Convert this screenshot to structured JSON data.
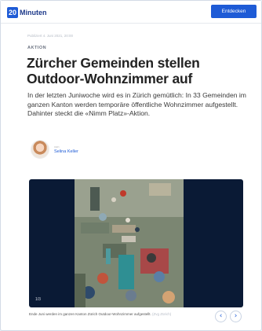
{
  "header": {
    "logo_mark": "20",
    "logo_text": "Minuten",
    "cta_label": "Entdecken"
  },
  "article": {
    "published": "Publiziert 4. Juni 2021, 20:00",
    "section": "AKTION",
    "headline": "Zürcher Gemeinden stellen Outdoor-Wohnzimmer auf",
    "lead": "In der letzten Juniwoche wird es in Zürich gemütlich: In 33 Gemeinden im ganzen Kanton werden temporäre öffentliche Wohnzimmer aufgestellt. Dahinter steckt die «Nimm Platz»-Aktion.",
    "author_by": "von",
    "author_name": "Selina Keller"
  },
  "gallery": {
    "counter": "1/3",
    "caption": "Ende Juni werden im ganzen Kanton Zürich Outdoor-Wohnzimmer aufgestellt.",
    "credit": "(Zvg Zürich)",
    "prev_icon": "chevron-left-icon",
    "next_icon": "chevron-right-icon"
  },
  "colors": {
    "brand": "#1e5bd6",
    "media_bg": "#0a1a35"
  }
}
